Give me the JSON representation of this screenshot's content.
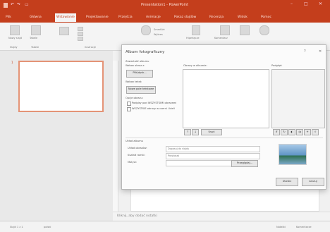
{
  "app": {
    "title": "Presentation1 - PowerPoint",
    "quick_access": [
      "save-icon",
      "undo-icon",
      "redo-icon",
      "present-icon"
    ]
  },
  "tabs": [
    {
      "label": "Plik"
    },
    {
      "label": "Główna"
    },
    {
      "label": "Wstawianie",
      "active": true
    },
    {
      "label": "Projektowanie"
    },
    {
      "label": "Przejścia"
    },
    {
      "label": "Animacje"
    },
    {
      "label": "Pokaz slajdów"
    },
    {
      "label": "Recenzja"
    },
    {
      "label": "Widok"
    },
    {
      "label": "Pomoc"
    }
  ],
  "ribbon": {
    "groups": [
      {
        "label": "Slajdy",
        "items": [
          "Nowy slajd",
          "Tabele"
        ]
      },
      {
        "label": "Ilustracje",
        "items": [
          "Obrazy",
          "Zrzut ekranu",
          "Album fotograficzny"
        ]
      },
      {
        "label": "Dodatki",
        "items": [
          "Kształty",
          "SmartArt",
          "Wykres"
        ]
      },
      {
        "label": "Linki",
        "items": [
          "Hiperłącze",
          "Akcja"
        ]
      },
      {
        "label": "Komentarze",
        "items": [
          "Komentarz"
        ]
      },
      {
        "label": "Tekst",
        "items": [
          "Pole tekstowe"
        ]
      }
    ],
    "labels": {
      "new_slide": "Nowy slajd",
      "table": "Tabele",
      "slides_group": "Slajdy",
      "tables_group": "Tabele",
      "images_group": "Ilustracje",
      "shapes": "Kształty",
      "smartart": "SmartArt",
      "chart": "Wykres",
      "comment": "Komentarz",
      "link": "Hiperłącze"
    }
  },
  "thumbnail": {
    "number": "1"
  },
  "notes": {
    "placeholder": "Kliknij, aby dodać notatki"
  },
  "status": {
    "slide": "Slajd 1 z 1",
    "language": "polski",
    "notes": "Notatki",
    "comments": "Komentarze"
  },
  "dialog": {
    "title": "Album fotograficzny",
    "close": "✕",
    "help": "?",
    "content_label": "Zawartość albumu",
    "insert_from": "Wstaw obraz z:",
    "file_disk_button": "Plik/dysk...",
    "insert_text": "Wstaw tekst:",
    "new_textbox_button": "Nowe pole tekstowe",
    "picture_options": "Opcje obrazu:",
    "captions_below": "Podpisy pod WSZYSTKIMI obrazami",
    "all_bw": "WSZYSTKIE obrazy w czerni i bieli",
    "pictures_in_album": "Obrazy w albumie:",
    "preview": "Podgląd:",
    "remove_button": "Usuń",
    "layout_title": "Układ albumu",
    "picture_layout": "Układ obrazów:",
    "picture_layout_value": "Dopasuj do slajdu",
    "frame_shape": "Kształt ramki:",
    "frame_shape_value": "Prostokąt",
    "theme": "Motyw:",
    "browse_button": "Przeglądaj...",
    "create_button": "Utwórz",
    "cancel_button": "Anuluj"
  }
}
